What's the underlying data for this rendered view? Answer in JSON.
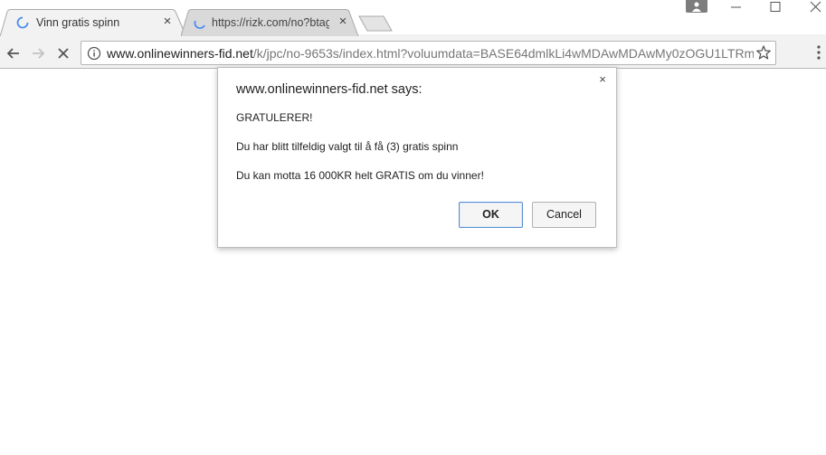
{
  "tabs": [
    {
      "title": "Vinn gratis spinn",
      "close": "×",
      "active": true
    },
    {
      "title": "https://rizk.com/no?btag",
      "close": "×",
      "active": false
    }
  ],
  "icons": {
    "tab_loading": "loading-spinner-icon",
    "profile": "profile-icon",
    "minimize": "minimize-icon",
    "maximize": "maximize-icon",
    "window_close": "window-close-icon",
    "back": "back-arrow-icon",
    "forward": "forward-arrow-icon",
    "stop": "stop-icon",
    "site_info": "info-icon",
    "bookmark": "star-icon",
    "menu": "kebab-menu-icon"
  },
  "address_bar": {
    "host": "www.onlinewinners-fid.net",
    "path": "/k/jpc/no-9653s/index.html?voluumdata=BASE64dmlkLi4wMDAwMDAwMy0zOGU1LTRm"
  },
  "dialog": {
    "title": "www.onlinewinners-fid.net says:",
    "close": "×",
    "lines": [
      "GRATULERER!",
      "Du har blitt tilfeldig valgt til å få (3) gratis spinn",
      "Du kan motta 16 000KR helt GRATIS om du vinner!"
    ],
    "ok_label": "OK",
    "cancel_label": "Cancel"
  },
  "colors": {
    "accent": "#4a8ef0",
    "toolbar": "#f2f2f2",
    "dialog_border": "#bdbdbd",
    "ok_border": "#5a8fd0"
  }
}
